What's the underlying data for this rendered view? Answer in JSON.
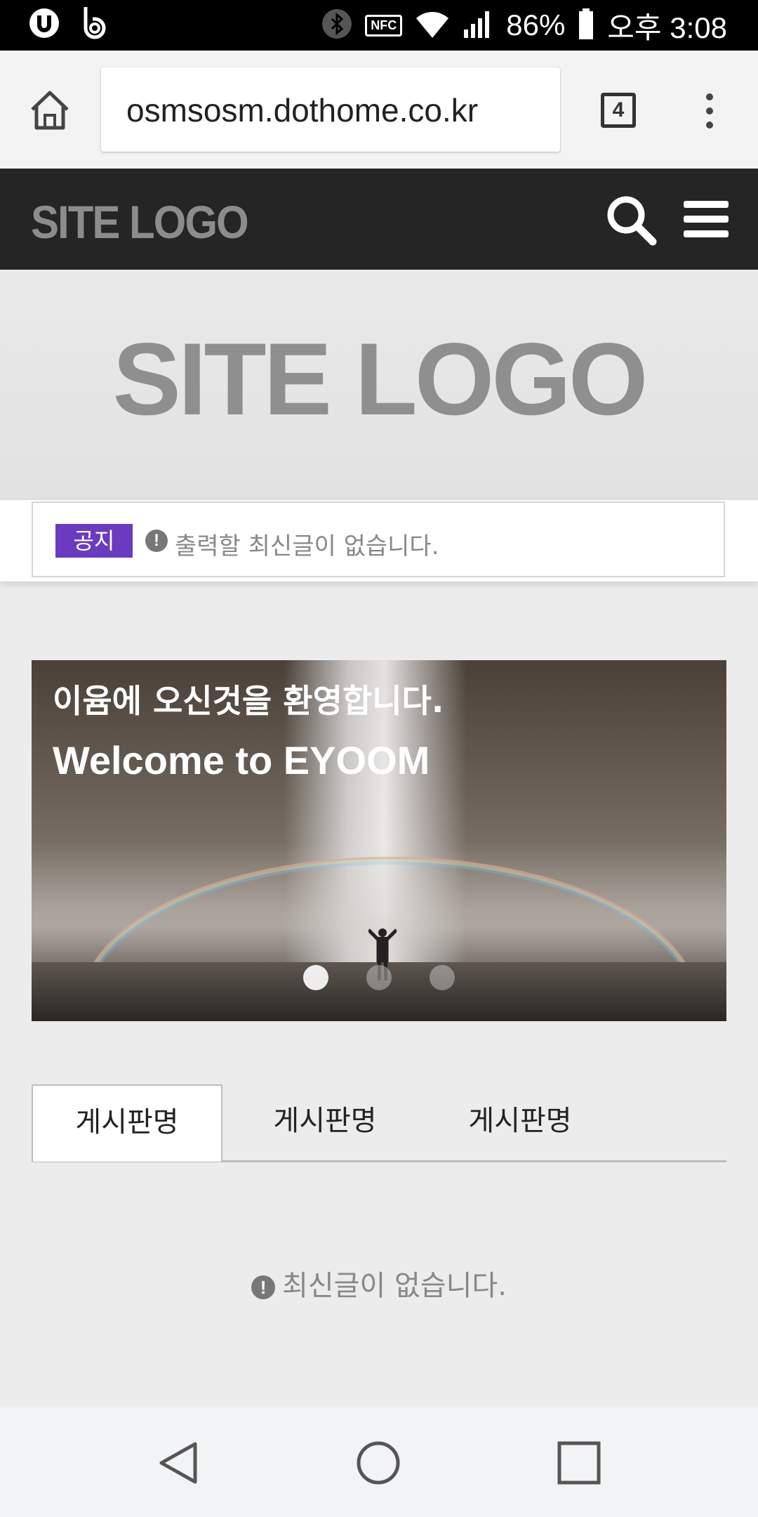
{
  "status_bar": {
    "battery": "86%",
    "time": "오후 3:08",
    "nfc": "NFC"
  },
  "browser": {
    "url": "osmsosm.dothome.co.kr",
    "tab_count": "4"
  },
  "site_header": {
    "logo": "SITE LOGO"
  },
  "hero": {
    "logo": "SITE LOGO"
  },
  "notice": {
    "badge": "공지",
    "icon": "!",
    "text": "출력할 최신글이 없습니다."
  },
  "slider": {
    "title_ko": "이윰에 오신것을 환영합니다.",
    "title_en": "Welcome to EYOOM",
    "active_slide": 1
  },
  "board": {
    "tabs": [
      {
        "label": "게시판명"
      },
      {
        "label": "게시판명"
      },
      {
        "label": "게시판명"
      }
    ],
    "empty_icon": "!",
    "empty_text": "최신글이 없습니다."
  },
  "colors": {
    "header_bg": "#252525",
    "notice_badge": "#6a3bbf"
  }
}
